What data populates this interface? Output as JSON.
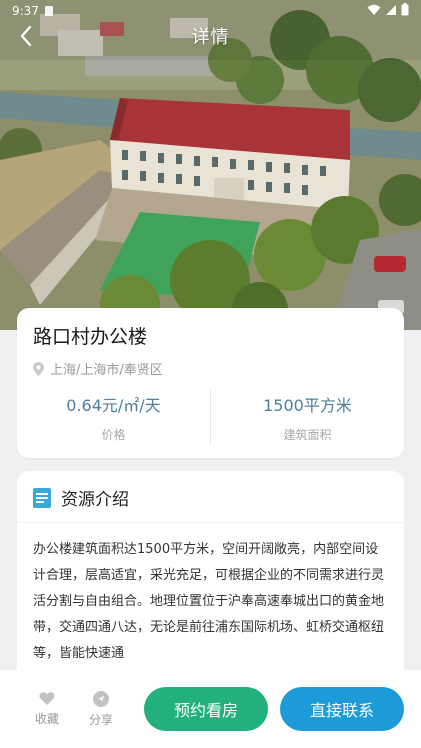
{
  "status_bar": {
    "time": "9:37"
  },
  "header": {
    "title": "详情"
  },
  "property": {
    "name": "路口村办公楼",
    "location": "上海/上海市/奉贤区",
    "price_value": "0.64元/㎡/天",
    "price_label": "价格",
    "area_value": "1500平方米",
    "area_label": "建筑面积"
  },
  "intro": {
    "title": "资源介绍",
    "text": "办公楼建筑面积达1500平方米，空间开阔敞亮，内部空间设计合理，层高适宜，采光充足，可根据企业的不同需求进行灵活分割与自由组合。地理位置位于沪奉高速奉城出口的黄金地带，交通四通八达，无论是前往浦东国际机场、虹桥交通枢纽等，皆能快速通"
  },
  "bottom_bar": {
    "favorite_label": "收藏",
    "share_label": "分享",
    "book_label": "预约看房",
    "contact_label": "直接联系"
  },
  "colors": {
    "accent_green": "#22b07c",
    "accent_blue": "#1d9bd8",
    "stat_value": "#4e7fa0"
  }
}
